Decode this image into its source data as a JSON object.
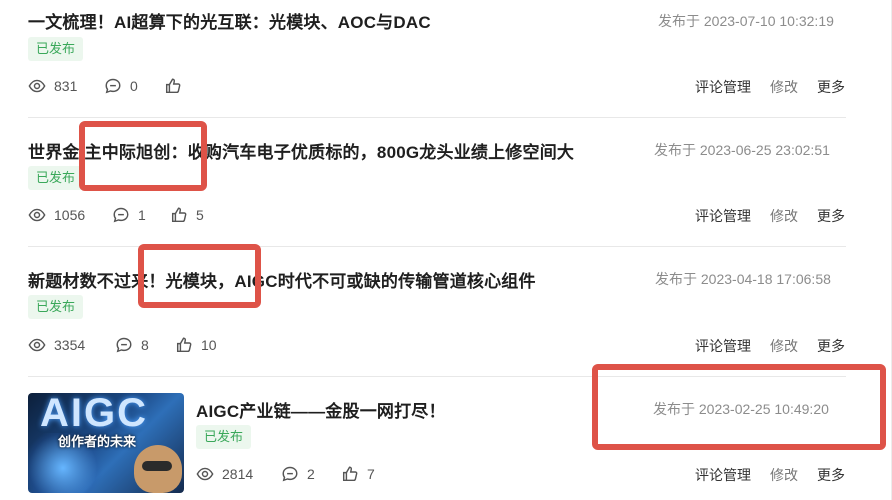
{
  "posts": [
    {
      "title": "一文梳理！AI超算下的光互联：光模块、AOC与DAC",
      "date": "发布于 2023-07-10 10:32:19",
      "status": "已发布",
      "views": "831",
      "comments": "0",
      "likes": "",
      "actions": {
        "comments": "评论管理",
        "edit": "修改",
        "more": "更多"
      }
    },
    {
      "title": "世界金 主中际旭创：收购汽车电子优质标的，800G龙头业绩上修空间大",
      "date": "发布于 2023-06-25 23:02:51",
      "status": "已发布",
      "views": "1056",
      "comments": "1",
      "likes": "5",
      "actions": {
        "comments": "评论管理",
        "edit": "修改",
        "more": "更多"
      }
    },
    {
      "title": "新题材数不过来！光模块，AIGC时代不可或缺的传输管道核心组件",
      "date": "发布于 2023-04-18 17:06:58",
      "status": "已发布",
      "views": "3354",
      "comments": "8",
      "likes": "10",
      "actions": {
        "comments": "评论管理",
        "edit": "修改",
        "more": "更多"
      }
    },
    {
      "title": "AIGC产业链——金股一网打尽！",
      "date": "发布于 2023-02-25 10:49:20",
      "status": "已发布",
      "views": "2814",
      "comments": "2",
      "likes": "7",
      "actions": {
        "comments": "评论管理",
        "edit": "修改",
        "more": "更多"
      },
      "thumbnail": {
        "logo": "AIGC",
        "subtitle": "创作者的未来"
      }
    }
  ],
  "icons": {
    "views": "eye-icon",
    "comments": "comment-icon",
    "likes": "thumbs-up-icon"
  },
  "colors": {
    "badge_bg": "#ecf7ee",
    "badge_text": "#3aa85a",
    "highlight": "#de5348",
    "muted": "#8c8c8c"
  }
}
